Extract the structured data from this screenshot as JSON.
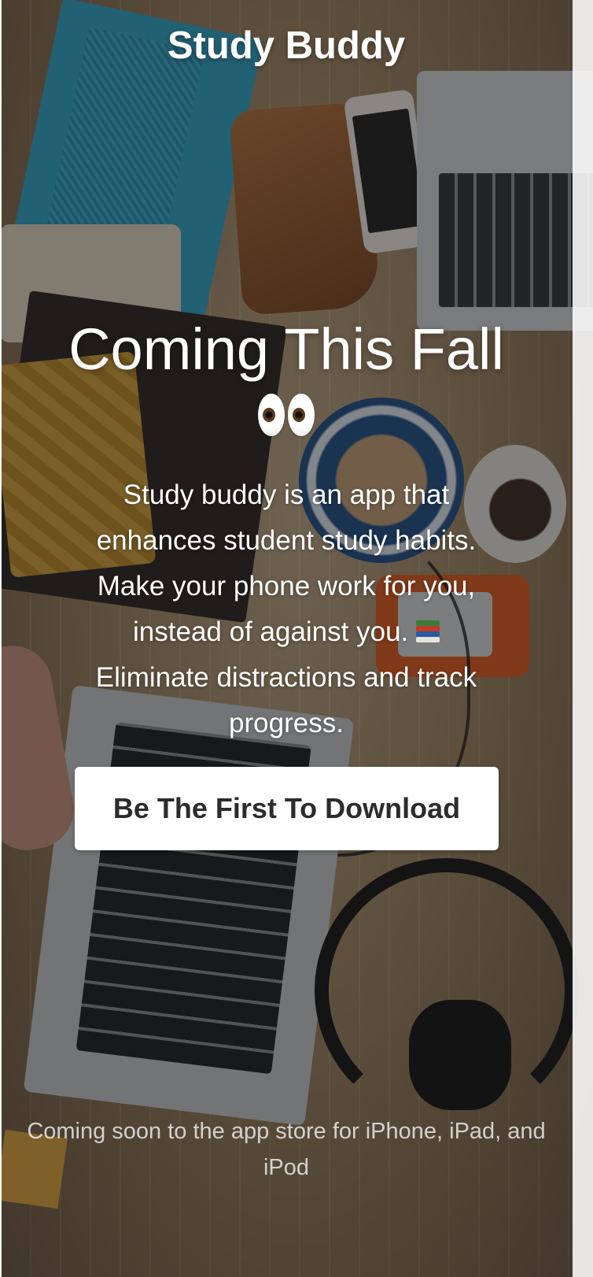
{
  "brand": {
    "title": "Study Buddy"
  },
  "hero": {
    "headline": "Coming This Fall",
    "headline_emoji": "eyes-icon",
    "description_part1": "Study buddy is an app that enhances student study habits. Make your phone work for you, instead of against you. ",
    "description_emoji": "books-icon",
    "description_part2": " Eliminate distractions and track progress."
  },
  "cta": {
    "label": "Be The First To Download"
  },
  "footer": {
    "note": "Coming soon to the app store for iPhone, iPad, and iPod"
  },
  "colors": {
    "overlay": "#141414",
    "button_background": "#ffffff",
    "button_text": "#2c2c2c",
    "text": "#ffffff"
  }
}
